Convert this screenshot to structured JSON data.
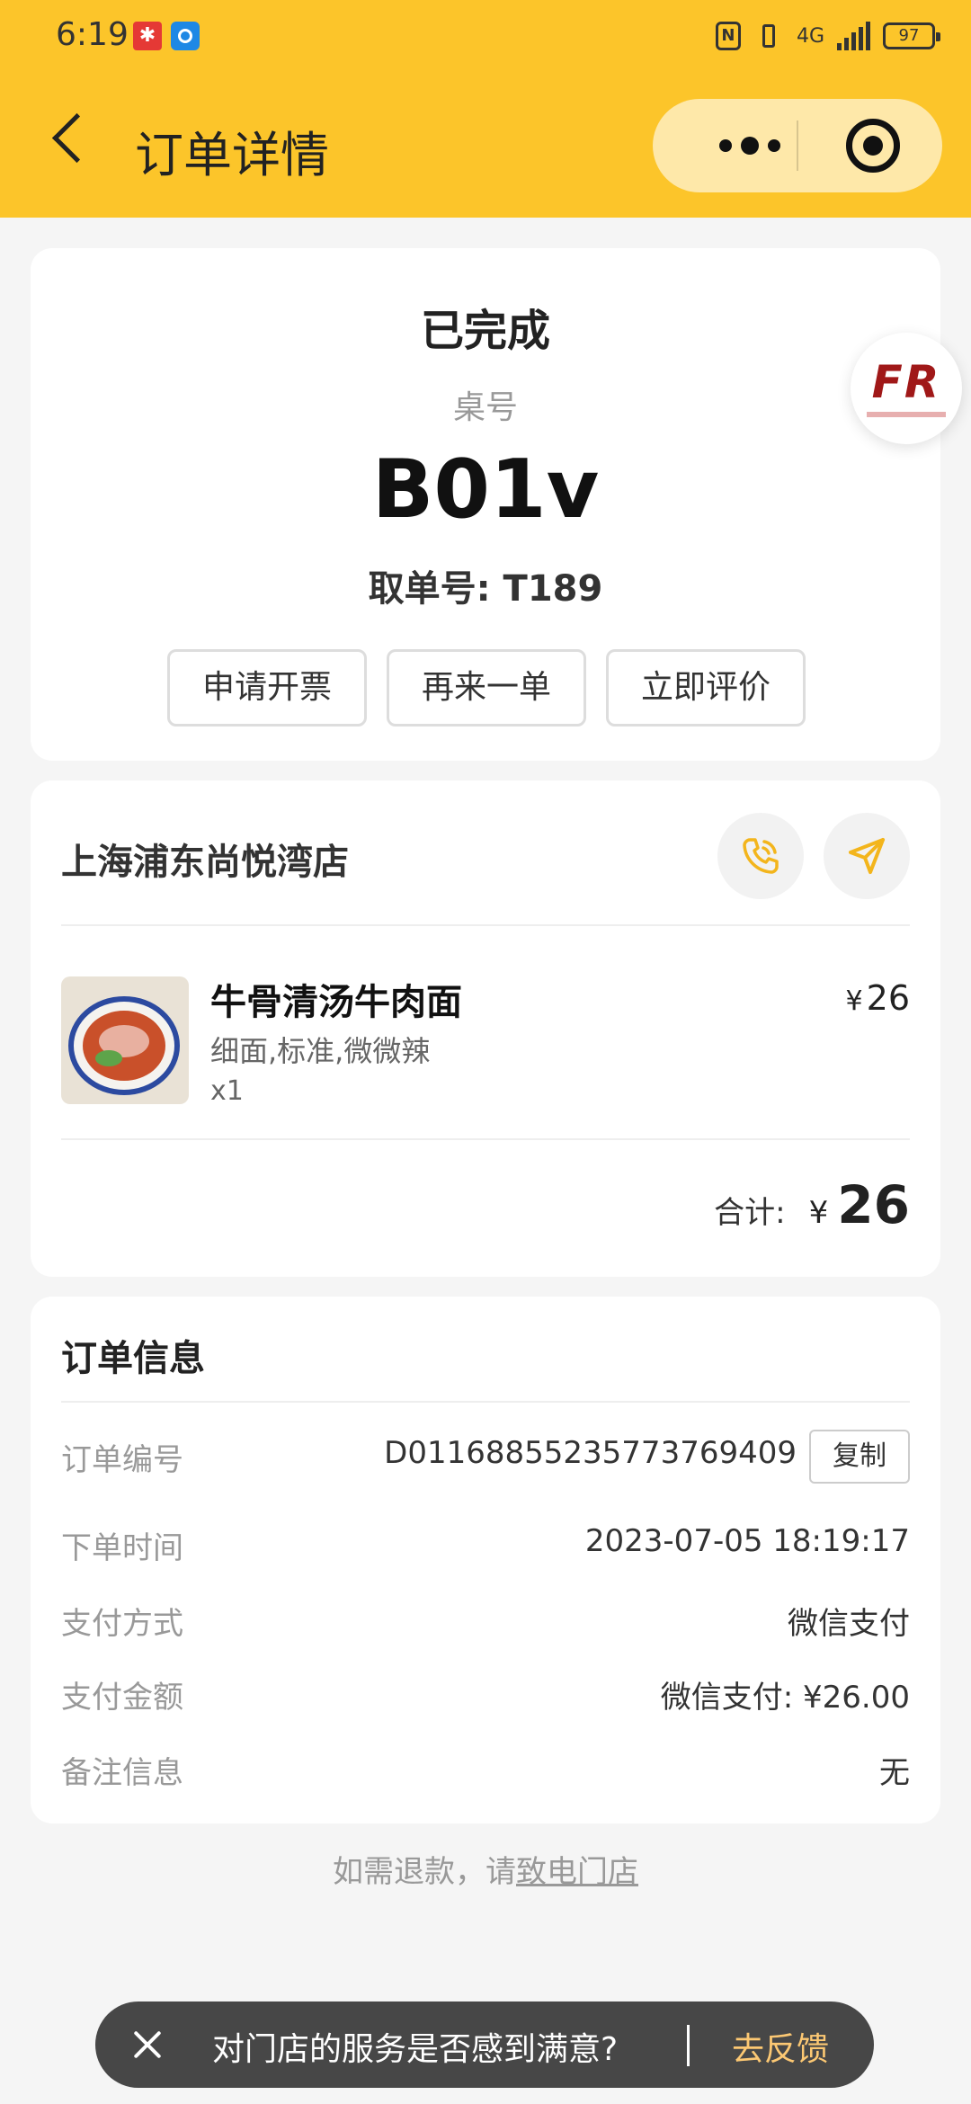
{
  "status_bar": {
    "time": "6:19",
    "network": "4G",
    "battery": "97"
  },
  "nav": {
    "title": "订单详情"
  },
  "order_status": {
    "status": "已完成",
    "table_label": "桌号",
    "table_no": "B01v",
    "pickup": "取单号: T189",
    "buttons": [
      "申请开票",
      "再来一单",
      "立即评价"
    ]
  },
  "badge": {
    "text": "FR"
  },
  "store": {
    "name": "上海浦东尚悦湾店",
    "item": {
      "name": "牛骨清汤牛肉面",
      "spec": "细面,标准,微微辣",
      "qty": "x1",
      "currency": "¥",
      "price": "26"
    },
    "total_label": "合计:",
    "total_currency": "¥",
    "total_amount": "26"
  },
  "order_info": {
    "title": "订单信息",
    "copy_label": "复制",
    "rows": [
      {
        "key": "订单编号",
        "value": "D01168855235773769409"
      },
      {
        "key": "下单时间",
        "value": "2023-07-05 18:19:17"
      },
      {
        "key": "支付方式",
        "value": "微信支付"
      },
      {
        "key": "支付金额",
        "value": "微信支付: ¥26.00"
      },
      {
        "key": "备注信息",
        "value": "无"
      }
    ]
  },
  "refund": {
    "text": "如需退款，请",
    "link": "致电门店"
  },
  "toast": {
    "message": "对门店的服务是否感到满意?",
    "action": "去反馈"
  },
  "colors": {
    "brand_yellow": "#fcc52a",
    "icon_yellow": "#f3b51c",
    "feedback_link": "#fcc873"
  }
}
